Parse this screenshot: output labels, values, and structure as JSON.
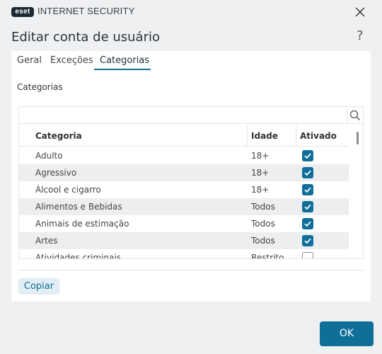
{
  "app": {
    "logo_text": "eset",
    "product_name": "INTERNET SECURITY"
  },
  "dialog": {
    "title": "Editar conta de usuário",
    "help": "?"
  },
  "tabs": [
    {
      "label": "Geral",
      "active": false
    },
    {
      "label": "Exceções",
      "active": false
    },
    {
      "label": "Categorias",
      "active": true
    }
  ],
  "section": {
    "label": "Categorias"
  },
  "search": {
    "placeholder": ""
  },
  "table": {
    "columns": [
      "Categoria",
      "Idade",
      "Ativado"
    ],
    "rows": [
      {
        "category": "Adulto",
        "age": "18+",
        "enabled": true
      },
      {
        "category": "Agressivo",
        "age": "18+",
        "enabled": true
      },
      {
        "category": "Álcool e cigarro",
        "age": "18+",
        "enabled": true
      },
      {
        "category": "Alimentos e Bebidas",
        "age": "Todos",
        "enabled": true
      },
      {
        "category": "Animais de estimação",
        "age": "Todos",
        "enabled": true
      },
      {
        "category": "Artes",
        "age": "Todos",
        "enabled": true
      },
      {
        "category": "Atividades criminais",
        "age": "Restrito",
        "enabled": false
      }
    ]
  },
  "buttons": {
    "copy": "Copiar",
    "ok": "OK"
  },
  "colors": {
    "accent": "#0e6f99",
    "row_alt": "#eceeef",
    "background": "#eef0f2"
  }
}
